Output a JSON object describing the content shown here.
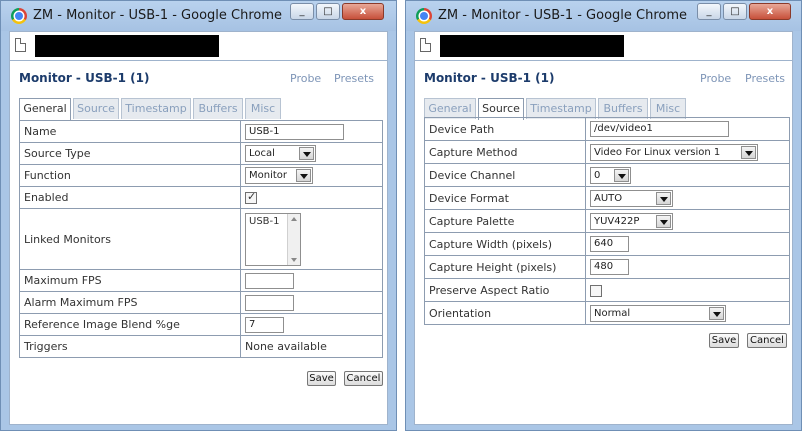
{
  "left_window": {
    "title": "ZM - Monitor - USB-1 - Google Chrome",
    "window_controls": {
      "minimize": "_",
      "maximize": "□",
      "close": "x"
    },
    "monitor_title": "Monitor - USB-1 (1)",
    "links": {
      "probe": "Probe",
      "presets": "Presets"
    },
    "tabs": [
      "General",
      "Source",
      "Timestamp",
      "Buffers",
      "Misc"
    ],
    "active_tab": "General",
    "fields": {
      "name_label": "Name",
      "name_value": "USB-1",
      "source_type_label": "Source Type",
      "source_type_value": "Local",
      "function_label": "Function",
      "function_value": "Monitor",
      "enabled_label": "Enabled",
      "linked_monitors_label": "Linked Monitors",
      "linked_monitors_option": "USB-1",
      "max_fps_label": "Maximum FPS",
      "alarm_max_fps_label": "Alarm Maximum FPS",
      "ref_blend_label": "Reference Image Blend %ge",
      "ref_blend_value": "7",
      "triggers_label": "Triggers",
      "triggers_value": "None available"
    },
    "buttons": {
      "save": "Save",
      "cancel": "Cancel"
    }
  },
  "right_window": {
    "title": "ZM - Monitor - USB-1 - Google Chrome",
    "window_controls": {
      "minimize": "_",
      "maximize": "□",
      "close": "x"
    },
    "monitor_title": "Monitor - USB-1 (1)",
    "links": {
      "probe": "Probe",
      "presets": "Presets"
    },
    "tabs": [
      "General",
      "Source",
      "Timestamp",
      "Buffers",
      "Misc"
    ],
    "active_tab": "Source",
    "fields": {
      "device_path_label": "Device Path",
      "device_path_value": "/dev/video1",
      "capture_method_label": "Capture Method",
      "capture_method_value": "Video For Linux version 1",
      "device_channel_label": "Device Channel",
      "device_channel_value": "0",
      "device_format_label": "Device Format",
      "device_format_value": "AUTO",
      "capture_palette_label": "Capture Palette",
      "capture_palette_value": "YUV422P",
      "capture_width_label": "Capture Width (pixels)",
      "capture_width_value": "640",
      "capture_height_label": "Capture Height (pixels)",
      "capture_height_value": "480",
      "preserve_aspect_label": "Preserve Aspect Ratio",
      "orientation_label": "Orientation",
      "orientation_value": "Normal"
    },
    "buttons": {
      "save": "Save",
      "cancel": "Cancel"
    }
  },
  "colors": {
    "window_frame": "#aac6e6",
    "title_text": "#1c3b6b",
    "link": "#7e95b7",
    "table_border": "#8d9cb0"
  }
}
